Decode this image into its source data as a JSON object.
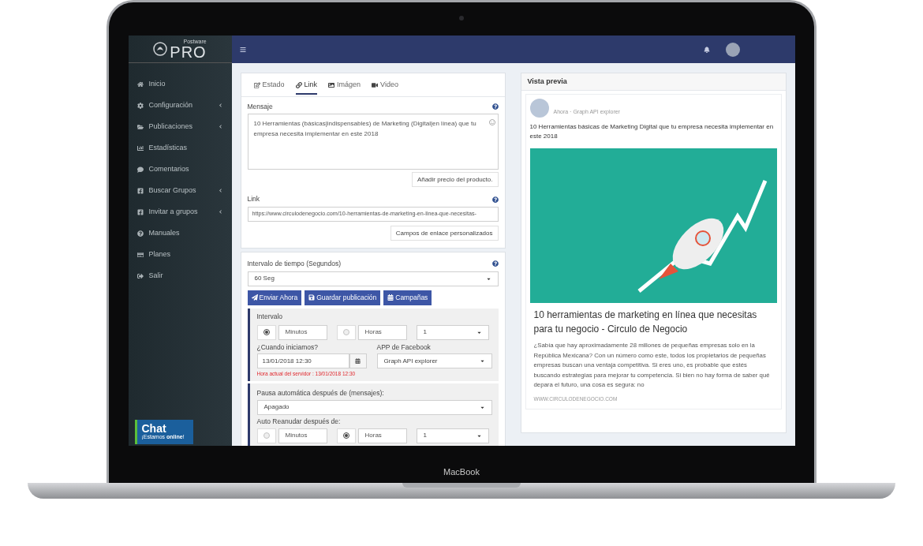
{
  "device": {
    "label": "MacBook"
  },
  "sidebar": {
    "logo": {
      "small": "Postware",
      "big": "PRO"
    },
    "items": [
      {
        "label": "Inicio",
        "has_submenu": false
      },
      {
        "label": "Configuración",
        "has_submenu": true
      },
      {
        "label": "Publicaciones",
        "has_submenu": true
      },
      {
        "label": "Estadísticas",
        "has_submenu": false
      },
      {
        "label": "Comentarios",
        "has_submenu": false
      },
      {
        "label": "Buscar Grupos",
        "has_submenu": true
      },
      {
        "label": "Invitar a grupos",
        "has_submenu": true
      },
      {
        "label": "Manuales",
        "has_submenu": false
      },
      {
        "label": "Planes",
        "has_submenu": false
      },
      {
        "label": "Salir",
        "has_submenu": false
      }
    ],
    "chat": {
      "title": "Chat",
      "subtitle": "¡Estamos **online**!"
    }
  },
  "tabs": [
    {
      "label": "Estado",
      "selected": false
    },
    {
      "label": "Link",
      "selected": true
    },
    {
      "label": "Imágen",
      "selected": false
    },
    {
      "label": "Video",
      "selected": false
    }
  ],
  "message": {
    "label": "Mensaje",
    "value": "10 Herramientas (básicas|indispensables) de Marketing (Digital|en línea) que tu empresa necesita implementar en este 2018",
    "button": "Añadir precio del producto."
  },
  "link": {
    "label": "Link",
    "value": "https://www.circulodenegocio.com/10-herramientas-de-marketing-en-linea-que-necesitas-",
    "button": "Campos de enlace personalizados"
  },
  "interval": {
    "label": "Intervalo de tiempo (Segundos)",
    "value": "60 Seg"
  },
  "actions": [
    "Enviar Ahora",
    "Guardar publicación",
    "Campañas"
  ],
  "schedule": {
    "label": "Intervalo",
    "units": [
      {
        "label": "Minutos",
        "selected": true
      },
      {
        "label": "Horas",
        "selected": false
      }
    ],
    "count": "1",
    "start_label": "¿Cuando iniciamos?",
    "start_value": "13/01/2018 12:30",
    "server_time": "Hora actual del servidor : 13/01/2018 12:30",
    "app_label": "APP de Facebook",
    "app_value": "Graph API explorer"
  },
  "pause": {
    "label": "Pausa automática después de (mensajes):",
    "value": "Apagado",
    "resume_label": "Auto Reanudar después de:",
    "units": [
      {
        "label": "Minutos",
        "selected": false
      },
      {
        "label": "Horas",
        "selected": true
      }
    ],
    "count": "1"
  },
  "preview": {
    "title": "Vista previa",
    "meta": "Ahora · Graph API explorer",
    "text": "10 Herramientas básicas de Marketing Digital que tu empresa necesita implementar en este 2018",
    "link_title": "10 herramientas de marketing en línea que necesitas para tu negocio - Circulo de Negocio",
    "description": "¿Sabía que hay aproximadamente 28 millones de pequeñas empresas solo en la República Mexicana? Con un número como este, todos los propietarios de pequeñas empresas buscan una ventaja competitiva. Si eres uno, es probable que estés buscando estrategias para mejorar tu competencia. Si bien no hay forma de saber qué depara el futuro, una cosa es segura: no",
    "domain": "WWW.CIRCULODENEGOCIO.COM"
  }
}
